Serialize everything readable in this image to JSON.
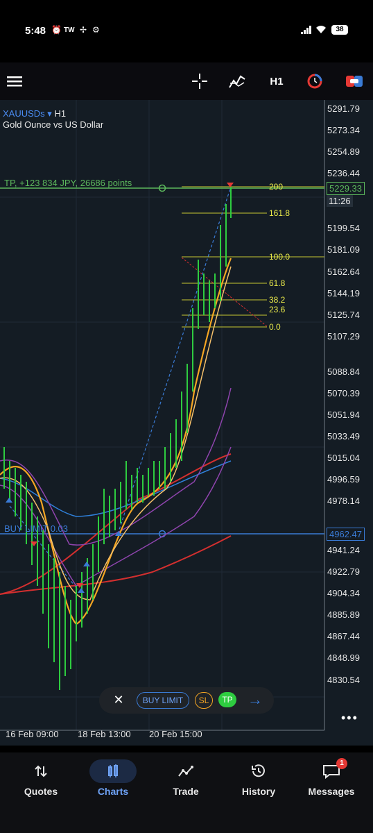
{
  "status_bar": {
    "time": "5:48",
    "carrier": "TW",
    "battery": "38"
  },
  "toolbar": {
    "timeframe": "H1",
    "icons": [
      "menu-icon",
      "crosshair-icon",
      "indicators-icon",
      "timeframe-H1",
      "clock-icon",
      "trade-toggle-icon"
    ]
  },
  "chart": {
    "symbol": "XAUUSDs",
    "timeframe": "H1",
    "description": "Gold Ounce vs US Dollar",
    "tp_label": "TP, +123 834 JPY, 26686 points",
    "buy_limit_label": "BUY LIMIT 0.03",
    "price_ticks": [
      "5291.79",
      "5273.34",
      "5254.89",
      "5236.44",
      "5199.54",
      "5181.09",
      "5162.64",
      "5144.19",
      "5125.74",
      "5107.29",
      "5088.84",
      "5070.39",
      "5051.94",
      "5033.49",
      "5015.04",
      "4996.59",
      "4978.14",
      "4941.24",
      "4922.79",
      "4904.34",
      "4885.89",
      "4867.44",
      "4848.99",
      "4830.54"
    ],
    "current_price": "5229.33",
    "countdown": "11:26",
    "buy_limit_price": "4962.47",
    "fib_levels": [
      "200",
      "161.8",
      "100.0",
      "61.8",
      "38.2",
      "23.6",
      "0.0"
    ],
    "time_labels": [
      "16 Feb 09:00",
      "18 Feb 13:00",
      "20 Feb 15:00"
    ],
    "colors": {
      "background": "#141c24",
      "tp_line": "#5cb85c",
      "buy_limit_line": "#3a7bd5",
      "fib": "#c8c832",
      "candles": "#2ecc40",
      "ma_orange": "#f5a623",
      "ma_red": "#d32f2f",
      "ma_purple": "#8e44ad",
      "ma_blue": "#2f7fd8"
    }
  },
  "trade_bar": {
    "close": "✕",
    "order_type": "BUY LIMIT",
    "sl": "SL",
    "tp": "TP",
    "arrow": "→"
  },
  "bottom_nav": {
    "items": [
      {
        "label": "Quotes",
        "icon": "quotes-icon"
      },
      {
        "label": "Charts",
        "icon": "charts-icon",
        "active": true
      },
      {
        "label": "Trade",
        "icon": "trade-icon"
      },
      {
        "label": "History",
        "icon": "history-icon"
      },
      {
        "label": "Messages",
        "icon": "messages-icon",
        "badge": "1"
      }
    ]
  }
}
